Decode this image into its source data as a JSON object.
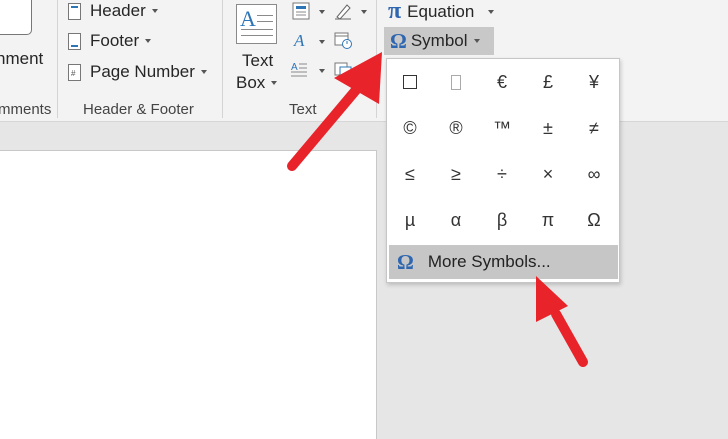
{
  "ribbon": {
    "comment_label": "nment",
    "comments_group_label": "mments",
    "header_label": "Header",
    "footer_label": "Footer",
    "page_number_label": "Page Number",
    "header_footer_group_label": "Header & Footer",
    "textbox_line1": "Text",
    "textbox_line2": "Box",
    "text_group_label": "Text",
    "equation_label": "Equation",
    "equation_icon": "π",
    "symbol_label": "Symbol",
    "symbol_icon": "Ω"
  },
  "symbol_menu": {
    "symbols": [
      [
        "☐",
        "",
        "€",
        "£",
        "¥"
      ],
      [
        "©",
        "®",
        "™",
        "±",
        "≠"
      ],
      [
        "≤",
        "≥",
        "÷",
        "×",
        "∞"
      ],
      [
        "µ",
        "α",
        "β",
        "π",
        "Ω"
      ]
    ],
    "more_symbols_label": "More Symbols...",
    "more_symbols_icon": "Ω"
  },
  "colors": {
    "accent_blue": "#2e66b0",
    "arrow_red": "#e8232a",
    "hover_gray": "#c6c6c6"
  }
}
